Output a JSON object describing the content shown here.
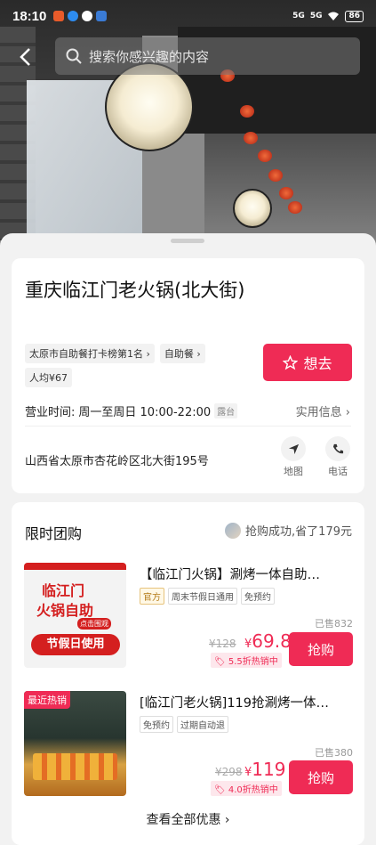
{
  "status_bar": {
    "time": "18:10",
    "signal_1": "5G",
    "signal_2": "5G",
    "battery": "86"
  },
  "header": {
    "search_placeholder": "搜索你感兴趣的内容"
  },
  "shop": {
    "name": "重庆临江门老火锅(北大街)",
    "tags": [
      "太原市自助餐打卡榜第1名",
      "自助餐",
      "人均¥67"
    ],
    "want_label": "想去",
    "hours_label": "营业时间:",
    "hours_value": "周一至周日 10:00-22:00",
    "hours_badge": "露台",
    "useful_info": "实用信息",
    "address": "山西省太原市杏花岭区北大街195号",
    "map_label": "地图",
    "phone_label": "电话"
  },
  "deals": {
    "title": "限时团购",
    "promo_text": "抢购成功,省了179元",
    "items": [
      {
        "title": "【临江门火锅】涮烤一体自助…",
        "tags": [
          "官方",
          "周末节假日通用",
          "免预约"
        ],
        "sold": "已售832",
        "original": "¥128",
        "price": "69.8",
        "discount": "5.5折热销中",
        "buy_label": "抢购",
        "thumb_text_1": "临江门",
        "thumb_text_2": "火锅自助",
        "thumb_badge": "点击围观",
        "thumb_text_3": "节假日使用"
      },
      {
        "title": "[临江门老火锅]119抢涮烤一体…",
        "tags": [
          "免预约",
          "过期自动退"
        ],
        "sold": "已售380",
        "original": "¥298",
        "price": "119",
        "discount": "4.0折热销中",
        "buy_label": "抢购",
        "thumb_badge": "最近热销"
      }
    ],
    "view_all": "查看全部优惠"
  },
  "colors": {
    "accent": "#ef2b55"
  }
}
